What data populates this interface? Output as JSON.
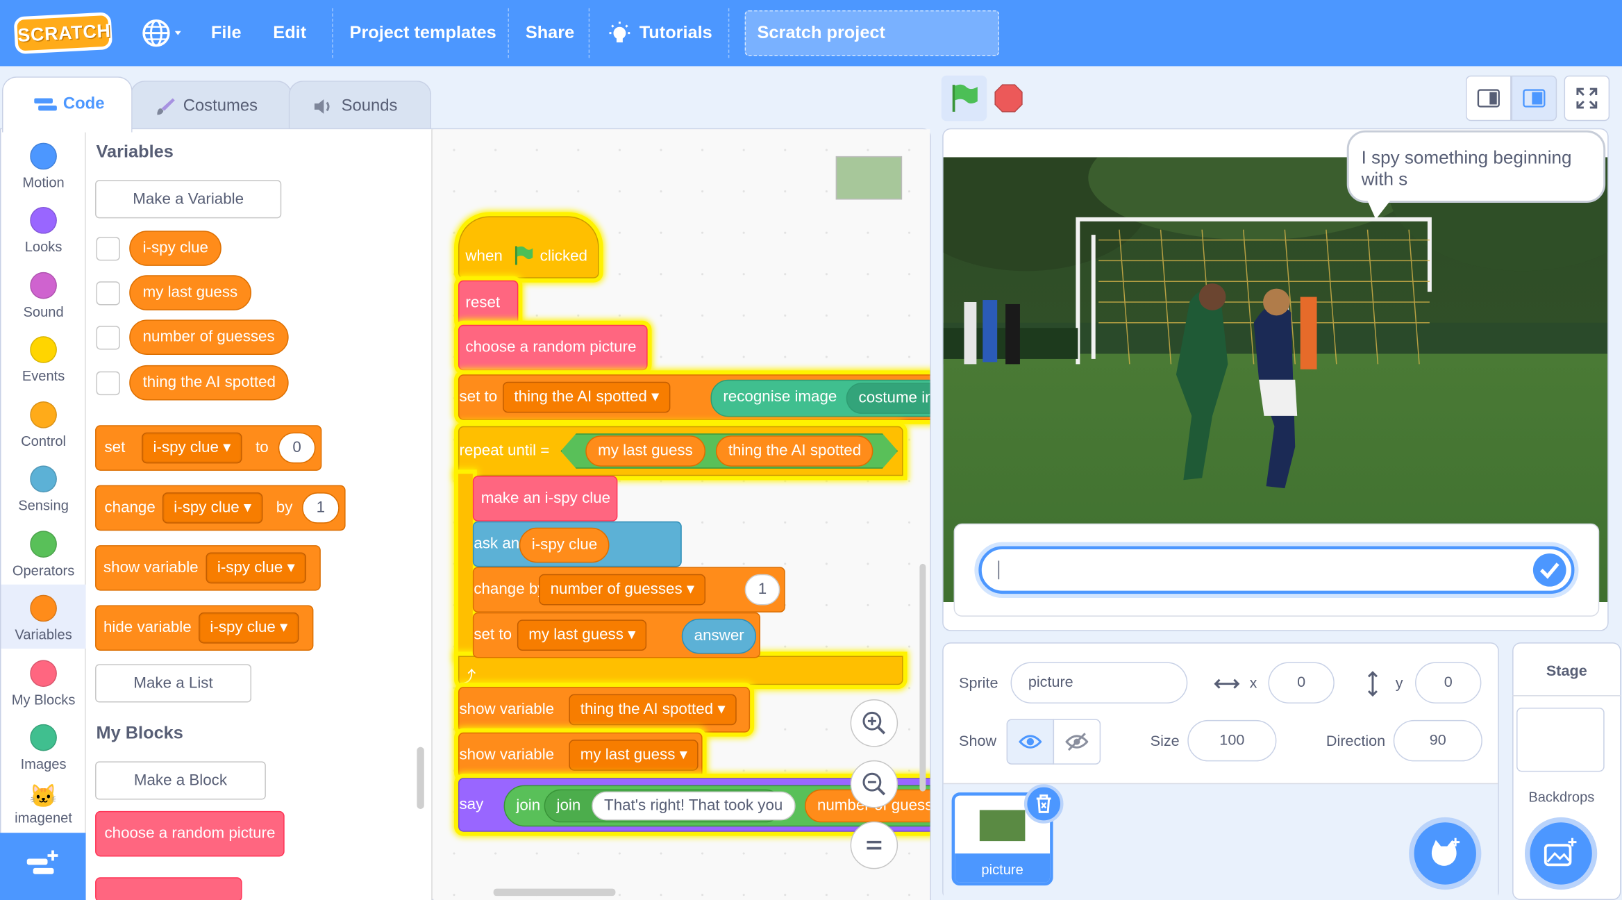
{
  "menubar": {
    "logo": "SCRATCH",
    "file": "File",
    "edit": "Edit",
    "project_templates": "Project templates",
    "share": "Share",
    "tutorials": "Tutorials",
    "project_title": "Scratch project"
  },
  "tabs": {
    "code": "Code",
    "costumes": "Costumes",
    "sounds": "Sounds"
  },
  "categories": [
    {
      "label": "Motion",
      "color": "#4c97ff"
    },
    {
      "label": "Looks",
      "color": "#9966ff"
    },
    {
      "label": "Sound",
      "color": "#cf63cf"
    },
    {
      "label": "Events",
      "color": "#ffd500"
    },
    {
      "label": "Control",
      "color": "#ffab19"
    },
    {
      "label": "Sensing",
      "color": "#5cb1d6"
    },
    {
      "label": "Operators",
      "color": "#59c059"
    },
    {
      "label": "Variables",
      "color": "#ff8c1a"
    },
    {
      "label": "My Blocks",
      "color": "#ff6680"
    },
    {
      "label": "Images",
      "color": "#40bf8f"
    },
    {
      "label": "imagenet",
      "color": ""
    }
  ],
  "palette": {
    "variables_title": "Variables",
    "make_variable": "Make a Variable",
    "variables": [
      "i-spy clue",
      "my last guess",
      "number of guesses",
      "thing the AI spotted"
    ],
    "set_block": {
      "set": "set",
      "var": "i-spy clue",
      "to": "to",
      "value": "0"
    },
    "change_block": {
      "change": "change",
      "var": "i-spy clue",
      "by": "by",
      "value": "1"
    },
    "show_block": {
      "label": "show variable",
      "var": "i-spy clue"
    },
    "hide_block": {
      "label": "hide variable",
      "var": "i-spy clue"
    },
    "make_list": "Make a List",
    "myblocks_title": "My Blocks",
    "make_block": "Make a Block",
    "custom_block": "choose a random picture"
  },
  "script": {
    "hat_when": "when",
    "hat_clicked": "clicked",
    "reset": "reset",
    "choose": "choose a random picture",
    "set1": {
      "set": "set",
      "var": "thing the AI spotted",
      "to": "to",
      "reporter": "recognise image",
      "arg": "costume im"
    },
    "repeat": {
      "label": "repeat until",
      "left": "my last guess",
      "op": "=",
      "right": "thing the AI spotted"
    },
    "make_clue": "make an i-spy clue",
    "ask": {
      "ask": "ask",
      "var": "i-spy clue",
      "wait": "and wait"
    },
    "change": {
      "change": "change",
      "var": "number of guesses",
      "by": "by",
      "value": "1"
    },
    "set2": {
      "set": "set",
      "var": "my last guess",
      "to": "to",
      "value": "answer"
    },
    "show1": {
      "label": "show variable",
      "var": "thing the AI spotted"
    },
    "show2": {
      "label": "show variable",
      "var": "my last guess"
    },
    "say": {
      "say": "say",
      "join1": "join",
      "join2": "join",
      "text": "That's right! That took you",
      "reporter": "number of guess"
    }
  },
  "stage": {
    "speech": "I spy something beginning with s"
  },
  "sprite_info": {
    "sprite_label": "Sprite",
    "sprite_name": "picture",
    "x_label": "x",
    "x": "0",
    "y_label": "y",
    "y": "0",
    "show_label": "Show",
    "size_label": "Size",
    "size": "100",
    "direction_label": "Direction",
    "direction": "90"
  },
  "sprite_tile": "picture",
  "stage_panel": {
    "title": "Stage",
    "backdrops": "Backdrops"
  },
  "colors": {
    "brand": "#4c97ff",
    "variables": "#ff8c1a",
    "myblocks": "#ff6680",
    "control": "#ffab19",
    "glow": "#fff200"
  }
}
